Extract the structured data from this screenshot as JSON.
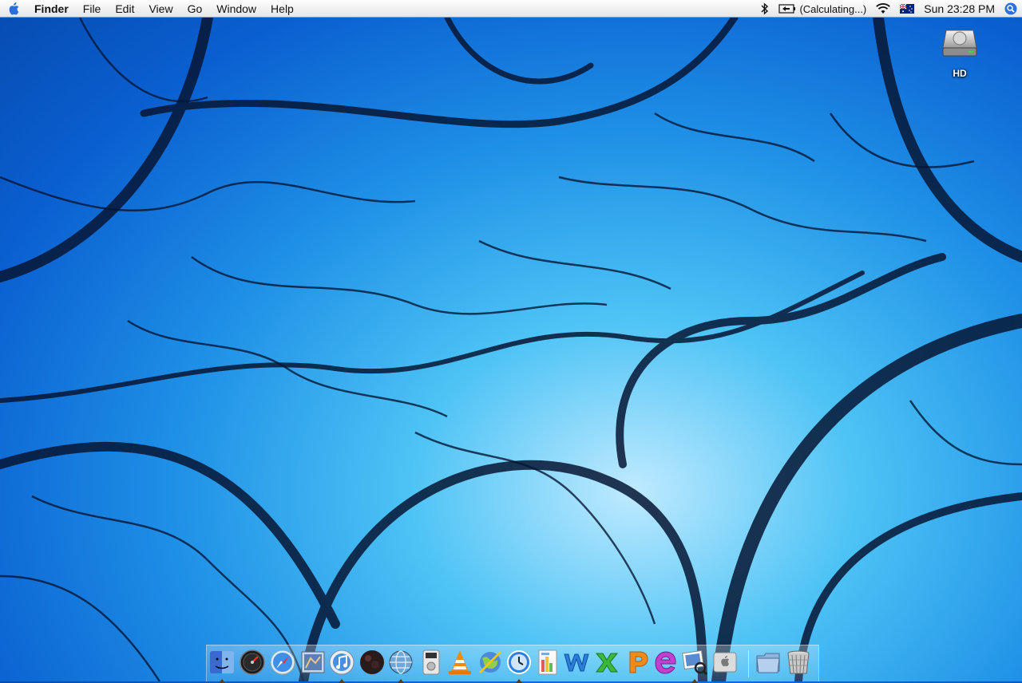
{
  "menubar": {
    "app_name": "Finder",
    "menus": [
      "File",
      "Edit",
      "View",
      "Go",
      "Window",
      "Help"
    ],
    "battery_status": "(Calculating...)",
    "clock": "Sun 23:28 PM",
    "input_flag": "australia-flag-icon"
  },
  "desktop": {
    "icons": [
      {
        "label": "HD",
        "icon": "hard-drive-icon"
      }
    ]
  },
  "dock": {
    "items": [
      {
        "name": "finder",
        "icon": "finder-icon",
        "running": true
      },
      {
        "name": "dashboard",
        "icon": "dashboard-icon",
        "running": false
      },
      {
        "name": "safari",
        "icon": "safari-icon",
        "running": false
      },
      {
        "name": "mail",
        "icon": "mail-icon",
        "running": false
      },
      {
        "name": "itunes",
        "icon": "itunes-icon",
        "running": true
      },
      {
        "name": "sphere-app",
        "icon": "dark-sphere-icon",
        "running": false
      },
      {
        "name": "network-globe",
        "icon": "globe-icon",
        "running": true
      },
      {
        "name": "dvd-player",
        "icon": "dvd-player-icon",
        "running": false
      },
      {
        "name": "vlc",
        "icon": "vlc-cone-icon",
        "running": false
      },
      {
        "name": "globe-tool",
        "icon": "globe-tool-icon",
        "running": false
      },
      {
        "name": "time-machine",
        "icon": "clock-icon",
        "running": true
      },
      {
        "name": "colored-doc",
        "icon": "document-icon",
        "running": false
      },
      {
        "name": "word",
        "icon": "word-w-icon",
        "running": false
      },
      {
        "name": "excel",
        "icon": "excel-x-icon",
        "running": false
      },
      {
        "name": "powerpoint",
        "icon": "powerpoint-p-icon",
        "running": false
      },
      {
        "name": "entourage",
        "icon": "entourage-e-icon",
        "running": false
      },
      {
        "name": "preview",
        "icon": "preview-icon",
        "running": true
      },
      {
        "name": "system-preferences",
        "icon": "apple-prefs-icon",
        "running": false
      },
      {
        "name": "documents",
        "icon": "folder-icon",
        "running": false
      },
      {
        "name": "trash",
        "icon": "trash-icon",
        "running": false
      }
    ]
  },
  "colors": {
    "menubar": "#eeeeee",
    "wallpaper_light": "#bfeaff",
    "wallpaper_dark": "#064bb0",
    "tendril": "#061634"
  }
}
